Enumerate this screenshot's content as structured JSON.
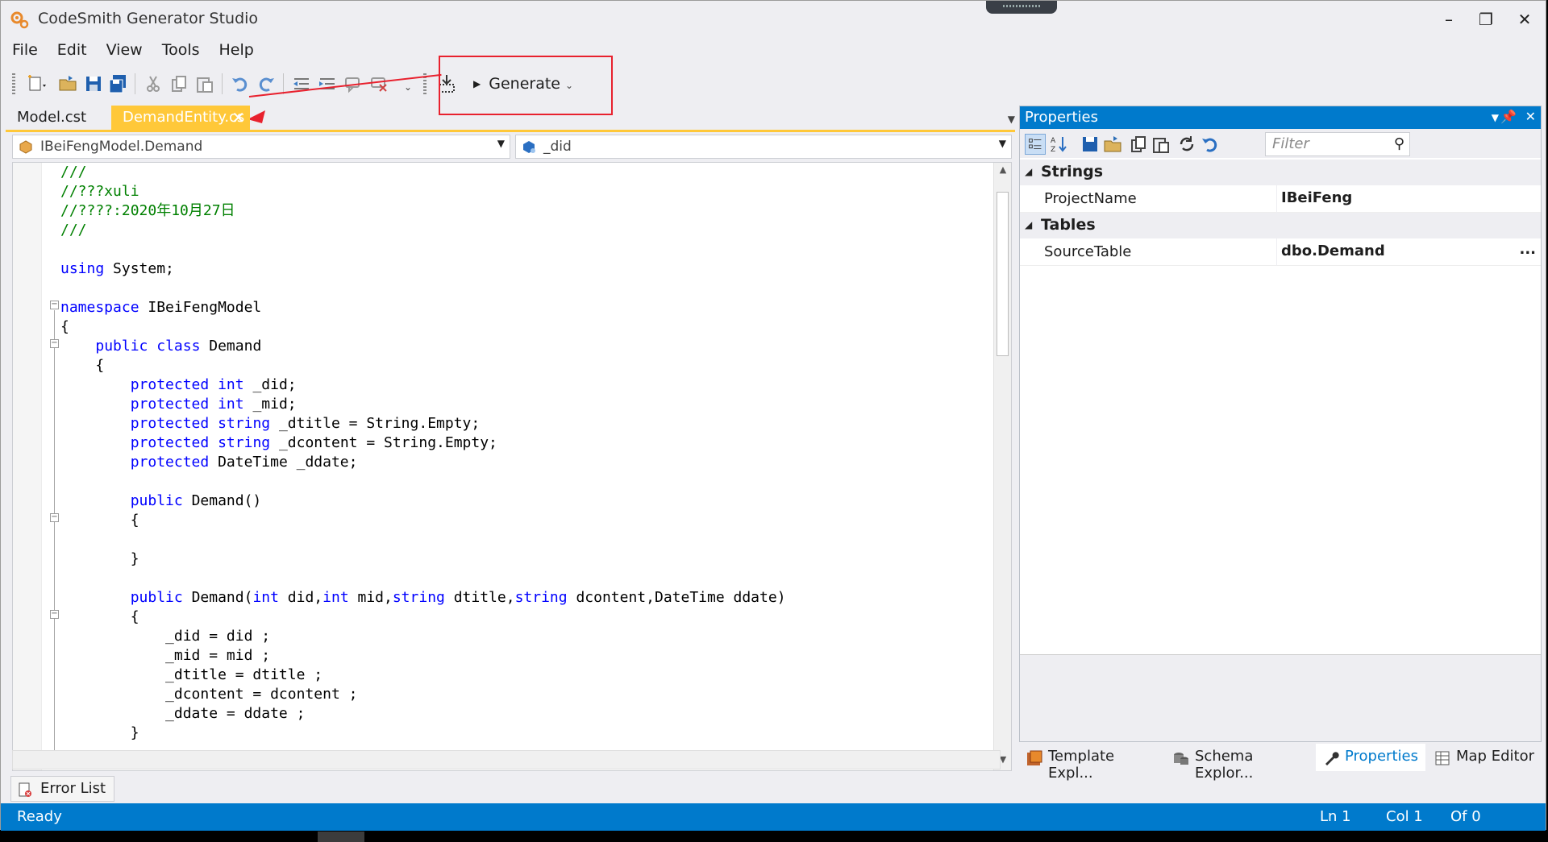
{
  "window": {
    "title": "CodeSmith Generator Studio"
  },
  "menu": [
    "File",
    "Edit",
    "View",
    "Tools",
    "Help"
  ],
  "toolbar": {
    "generate_label": "Generate"
  },
  "doc_tabs": [
    {
      "label": "Model.cst",
      "active": false
    },
    {
      "label": "DemandEntity.cs",
      "active": true
    }
  ],
  "nav": {
    "type_combo": "IBeiFengModel.Demand",
    "member_combo": "_did"
  },
  "code_lines": [
    {
      "indent": "",
      "parts": [
        {
          "t": "///",
          "c": "cm"
        }
      ]
    },
    {
      "indent": "",
      "parts": [
        {
          "t": "//???xuli",
          "c": "cm"
        }
      ]
    },
    {
      "indent": "",
      "parts": [
        {
          "t": "//????:2020年10月27日",
          "c": "cm"
        }
      ]
    },
    {
      "indent": "",
      "parts": [
        {
          "t": "///",
          "c": "cm"
        }
      ]
    },
    {
      "indent": "",
      "parts": []
    },
    {
      "indent": "",
      "parts": [
        {
          "t": "using",
          "c": "kw"
        },
        {
          "t": " System;",
          "c": ""
        }
      ]
    },
    {
      "indent": "",
      "parts": []
    },
    {
      "indent": "",
      "parts": [
        {
          "t": "namespace",
          "c": "kw"
        },
        {
          "t": " IBeiFengModel",
          "c": ""
        }
      ]
    },
    {
      "indent": "",
      "parts": [
        {
          "t": "{",
          "c": ""
        }
      ]
    },
    {
      "indent": "    ",
      "parts": [
        {
          "t": "public",
          "c": "kw"
        },
        {
          "t": " ",
          "c": ""
        },
        {
          "t": "class",
          "c": "kw"
        },
        {
          "t": " Demand",
          "c": ""
        }
      ]
    },
    {
      "indent": "    ",
      "parts": [
        {
          "t": "{",
          "c": ""
        }
      ]
    },
    {
      "indent": "        ",
      "parts": [
        {
          "t": "protected",
          "c": "kw"
        },
        {
          "t": " ",
          "c": ""
        },
        {
          "t": "int",
          "c": "kw"
        },
        {
          "t": " _did;",
          "c": ""
        }
      ]
    },
    {
      "indent": "        ",
      "parts": [
        {
          "t": "protected",
          "c": "kw"
        },
        {
          "t": " ",
          "c": ""
        },
        {
          "t": "int",
          "c": "kw"
        },
        {
          "t": " _mid;",
          "c": ""
        }
      ]
    },
    {
      "indent": "        ",
      "parts": [
        {
          "t": "protected",
          "c": "kw"
        },
        {
          "t": " ",
          "c": ""
        },
        {
          "t": "string",
          "c": "kw"
        },
        {
          "t": " _dtitle = String.Empty;",
          "c": ""
        }
      ]
    },
    {
      "indent": "        ",
      "parts": [
        {
          "t": "protected",
          "c": "kw"
        },
        {
          "t": " ",
          "c": ""
        },
        {
          "t": "string",
          "c": "kw"
        },
        {
          "t": " _dcontent = String.Empty;",
          "c": ""
        }
      ]
    },
    {
      "indent": "        ",
      "parts": [
        {
          "t": "protected",
          "c": "kw"
        },
        {
          "t": " DateTime _ddate;",
          "c": ""
        }
      ]
    },
    {
      "indent": "",
      "parts": []
    },
    {
      "indent": "        ",
      "parts": [
        {
          "t": "public",
          "c": "kw"
        },
        {
          "t": " Demand()",
          "c": ""
        }
      ]
    },
    {
      "indent": "        ",
      "parts": [
        {
          "t": "{",
          "c": ""
        }
      ]
    },
    {
      "indent": "",
      "parts": []
    },
    {
      "indent": "        ",
      "parts": [
        {
          "t": "}",
          "c": ""
        }
      ]
    },
    {
      "indent": "",
      "parts": []
    },
    {
      "indent": "        ",
      "parts": [
        {
          "t": "public",
          "c": "kw"
        },
        {
          "t": " Demand(",
          "c": ""
        },
        {
          "t": "int",
          "c": "kw"
        },
        {
          "t": " did,",
          "c": ""
        },
        {
          "t": "int",
          "c": "kw"
        },
        {
          "t": " mid,",
          "c": ""
        },
        {
          "t": "string",
          "c": "kw"
        },
        {
          "t": " dtitle,",
          "c": ""
        },
        {
          "t": "string",
          "c": "kw"
        },
        {
          "t": " dcontent,DateTime ddate)",
          "c": ""
        }
      ]
    },
    {
      "indent": "        ",
      "parts": [
        {
          "t": "{",
          "c": ""
        }
      ]
    },
    {
      "indent": "            ",
      "parts": [
        {
          "t": "_did = did ;",
          "c": ""
        }
      ]
    },
    {
      "indent": "            ",
      "parts": [
        {
          "t": "_mid = mid ;",
          "c": ""
        }
      ]
    },
    {
      "indent": "            ",
      "parts": [
        {
          "t": "_dtitle = dtitle ;",
          "c": ""
        }
      ]
    },
    {
      "indent": "            ",
      "parts": [
        {
          "t": "_dcontent = dcontent ;",
          "c": ""
        }
      ]
    },
    {
      "indent": "            ",
      "parts": [
        {
          "t": "_ddate = ddate ;",
          "c": ""
        }
      ]
    },
    {
      "indent": "        ",
      "parts": [
        {
          "t": "}",
          "c": ""
        }
      ]
    }
  ],
  "properties": {
    "title": "Properties",
    "filter_placeholder": "Filter",
    "categories": [
      {
        "name": "Strings",
        "rows": [
          {
            "name": "ProjectName",
            "value": "IBeiFeng"
          }
        ]
      },
      {
        "name": "Tables",
        "rows": [
          {
            "name": "SourceTable",
            "value": "dbo.Demand",
            "has_button": true
          }
        ]
      }
    ],
    "ellipsis": "..."
  },
  "tool_tabs": [
    {
      "label": "Template Expl...",
      "icon": "template-explorer-icon",
      "active": false
    },
    {
      "label": "Schema Explor...",
      "icon": "schema-explorer-icon",
      "active": false
    },
    {
      "label": "Properties",
      "icon": "wrench-icon",
      "active": true
    },
    {
      "label": "Map Editor",
      "icon": "map-editor-icon",
      "active": false
    }
  ],
  "error_list": {
    "label": "Error List"
  },
  "status": {
    "text": "Ready",
    "ln": "Ln 1",
    "col": "Col 1",
    "of": "Of 0"
  },
  "colors": {
    "accent": "#007acc",
    "active_tab": "#ffc839",
    "highlight": "#e8212e",
    "keyword": "#0000ff",
    "comment": "#008000"
  }
}
